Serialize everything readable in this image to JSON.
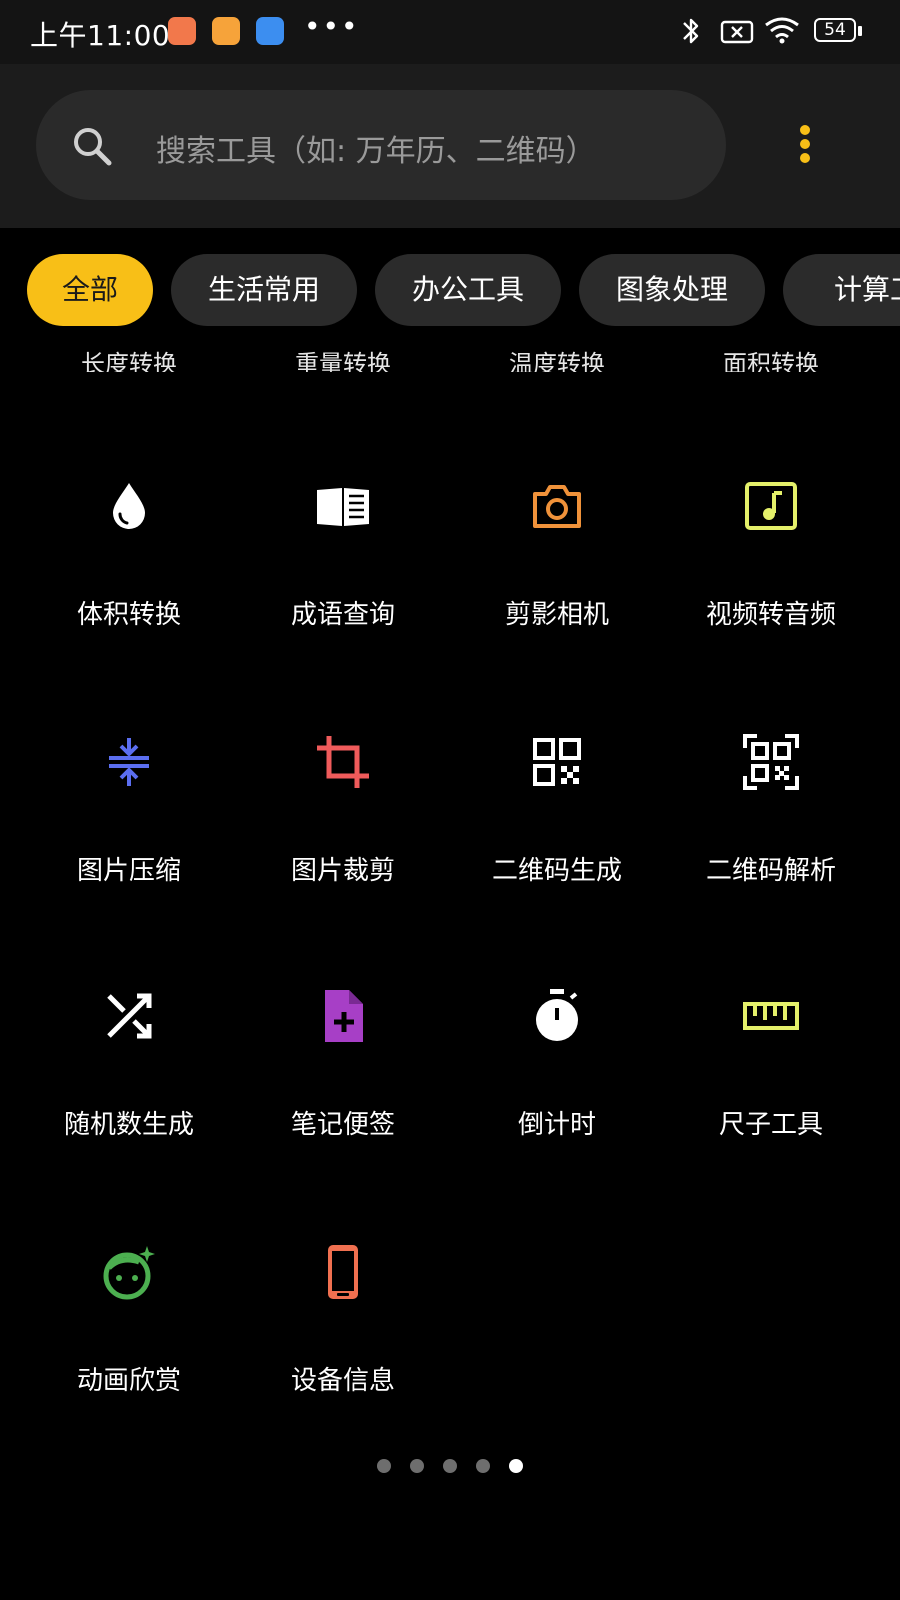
{
  "status_bar": {
    "time": "上午11:00",
    "more": "•••",
    "battery": "54"
  },
  "search": {
    "placeholder": "搜索工具（如: 万年历、二维码）"
  },
  "categories": [
    {
      "label": "全部",
      "active": true
    },
    {
      "label": "生活常用"
    },
    {
      "label": "办公工具"
    },
    {
      "label": "图象处理"
    },
    {
      "label": "计算工"
    }
  ],
  "partial_row": [
    "长度转换",
    "重量转换",
    "温度转换",
    "面积转换"
  ],
  "tools": [
    {
      "label": "体积转换",
      "icon": "water-drop-icon",
      "color": "#ffffff"
    },
    {
      "label": "成语查询",
      "icon": "book-icon",
      "color": "#ffffff"
    },
    {
      "label": "剪影相机",
      "icon": "camera-icon",
      "color": "#f0923a"
    },
    {
      "label": "视频转音频",
      "icon": "music-note-icon",
      "color": "#e4f06a"
    },
    {
      "label": "图片压缩",
      "icon": "compress-icon",
      "color": "#5b6ef0"
    },
    {
      "label": "图片裁剪",
      "icon": "crop-icon",
      "color": "#f05b5b"
    },
    {
      "label": "二维码生成",
      "icon": "qr-code-icon",
      "color": "#ffffff"
    },
    {
      "label": "二维码解析",
      "icon": "qr-scan-icon",
      "color": "#ffffff"
    },
    {
      "label": "随机数生成",
      "icon": "shuffle-icon",
      "color": "#ffffff"
    },
    {
      "label": "笔记便签",
      "icon": "note-add-icon",
      "color": "#a73fc6"
    },
    {
      "label": "倒计时",
      "icon": "timer-icon",
      "color": "#ffffff"
    },
    {
      "label": "尺子工具",
      "icon": "ruler-icon",
      "color": "#e4f06a"
    },
    {
      "label": "动画欣赏",
      "icon": "face-icon",
      "color": "#4caf50"
    },
    {
      "label": "设备信息",
      "icon": "phone-icon",
      "color": "#f07050"
    }
  ],
  "pager": {
    "count": 5,
    "active_index": 4
  }
}
